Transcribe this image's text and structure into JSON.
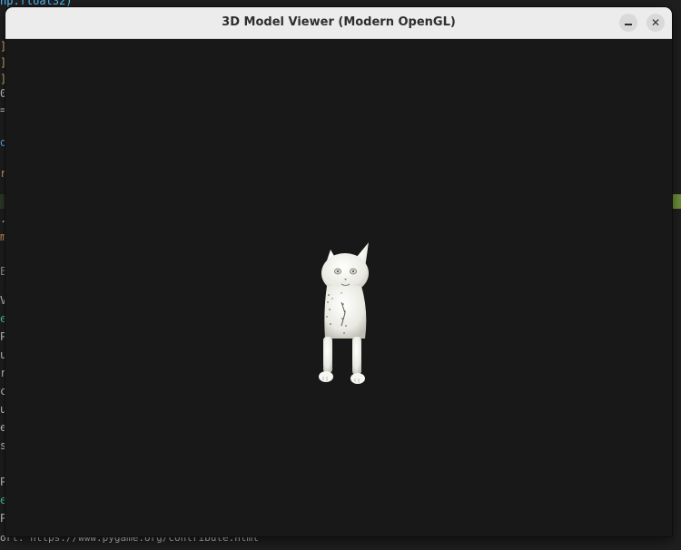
{
  "window": {
    "title": "3D Model Viewer (Modern OpenGL)",
    "minimize_icon": "minimize-icon",
    "close_icon": "close-icon",
    "close_glyph": "✕"
  },
  "background": {
    "top_code": "np.float32)",
    "bottom_text": "ort: https://www.pygame.org/contribute.html",
    "edge_chars": [
      "]",
      "]",
      "]",
      "0",
      "=",
      "o",
      "r",
      ".",
      "m",
      "E",
      "Ve",
      "es",
      "Py",
      "ur",
      "rt",
      "ce",
      "uc",
      "es",
      "st",
      "Py",
      "es",
      "Py"
    ]
  },
  "viewport": {
    "model_name": "cat-model",
    "background_color": "#181818",
    "model_color": "#f2f2ee"
  }
}
